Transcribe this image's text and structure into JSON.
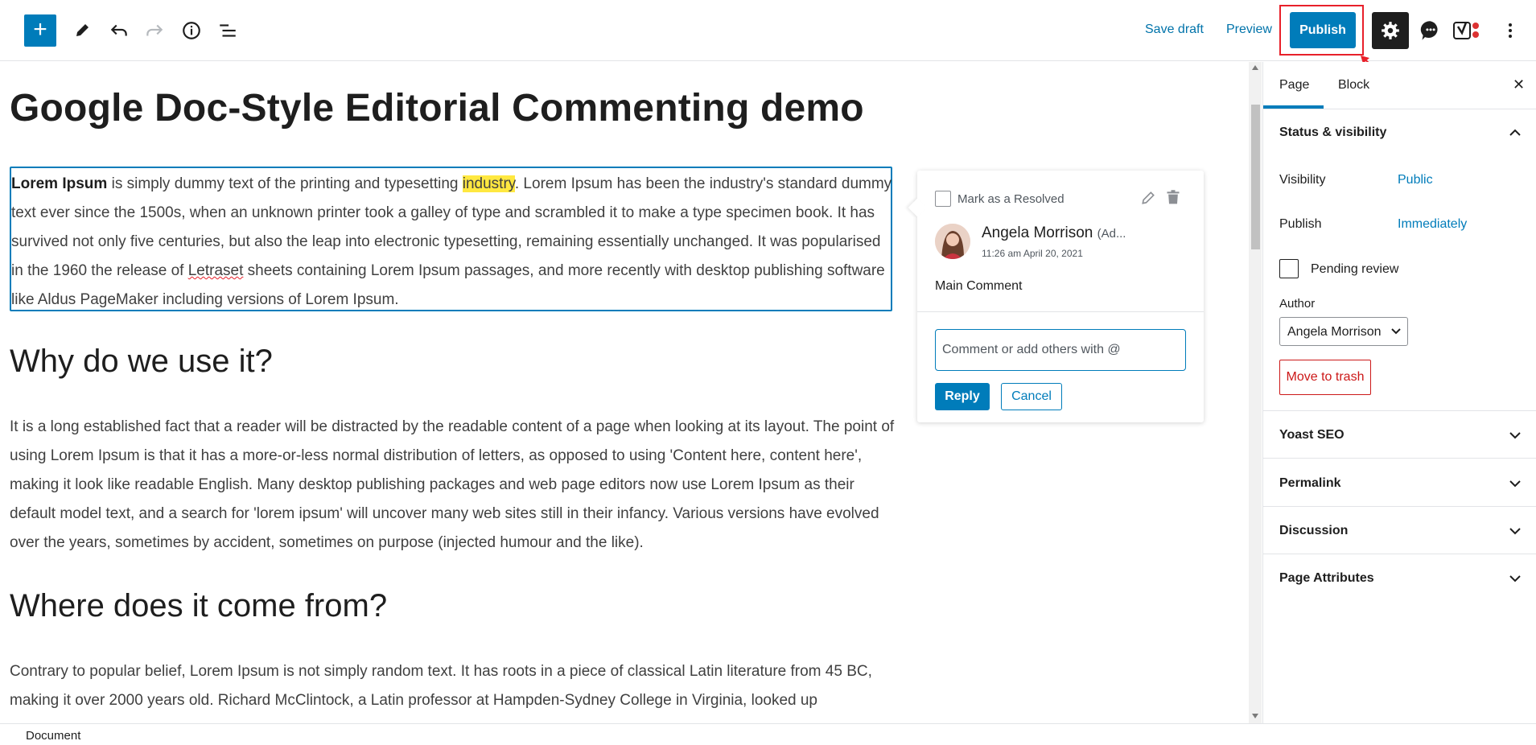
{
  "toolbar": {
    "add_block": "+",
    "save_draft": "Save draft",
    "preview": "Preview",
    "publish": "Publish",
    "icons": [
      "plus-icon",
      "pencil-icon",
      "undo-icon",
      "redo-icon",
      "info-icon",
      "list-view-icon",
      "gear-icon",
      "comment-icon",
      "yoast-icon",
      "more-vertical-icon"
    ]
  },
  "editor": {
    "title": "Google Doc-Style Editorial Commenting demo",
    "p1": {
      "bold": "Lorem Ipsum",
      "before_highlight": " is simply dummy text of the printing and typesetting ",
      "highlight": "industry",
      "after_highlight_1": ". Lorem Ipsum has been the industry's standard dummy text ever since the 1500s, when an unknown printer took a galley of type and scrambled it to make a type specimen book. It has survived not only five centuries, but also the leap into electronic typesetting, remaining essentially unchanged. It was popularised in the 1960 the release of ",
      "misspelled": "Letraset",
      "after_highlight_2": " sheets containing Lorem Ipsum passages, and more recently with desktop publishing software like Aldus PageMaker including versions of Lorem Ipsum."
    },
    "h2_1": "Why do we use it?",
    "p2": "It is a long established fact that a reader will be distracted by the readable content of a page when looking at its layout. The point of using Lorem Ipsum is that it has a more-or-less normal distribution of letters, as opposed to using 'Content here, content here', making it look like readable English. Many desktop publishing packages and web page editors now use Lorem Ipsum as their default model text, and a search for 'lorem ipsum' will uncover many web sites still in their infancy. Various versions have evolved over the years, sometimes by accident, sometimes on purpose (injected humour and the like).",
    "h2_2": "Where does it come from?",
    "p3": "Contrary to popular belief, Lorem Ipsum is not simply random text. It has roots in a piece of classical Latin literature from 45 BC, making it over 2000 years old. Richard McClintock, a Latin professor at Hampden-Sydney College in Virginia, looked up"
  },
  "comment": {
    "resolve_label": "Mark as a Resolved",
    "author": "Angela Morrison",
    "author_role": "(Ad...",
    "time": "11:26 am April 20, 2021",
    "text": "Main Comment",
    "input_placeholder": "Comment or add others with @",
    "reply": "Reply",
    "cancel": "Cancel"
  },
  "sidebar": {
    "tabs": [
      "Page",
      "Block"
    ],
    "active_tab": "Page",
    "close": "✕",
    "status_panel": {
      "title": "Status & visibility",
      "visibility_label": "Visibility",
      "visibility_value": "Public",
      "publish_label": "Publish",
      "publish_value": "Immediately",
      "pending_review": "Pending review",
      "author_label": "Author",
      "author_value": "Angela Morrison",
      "move_to_trash": "Move to trash"
    },
    "panels": [
      "Yoast SEO",
      "Permalink",
      "Discussion",
      "Page Attributes"
    ]
  },
  "footer": {
    "breadcrumb": "Document"
  },
  "colors": {
    "accent": "#007cba",
    "highlight": "#ffe840",
    "annotation_red": "#e8202a",
    "trash_red": "#cc1818"
  }
}
